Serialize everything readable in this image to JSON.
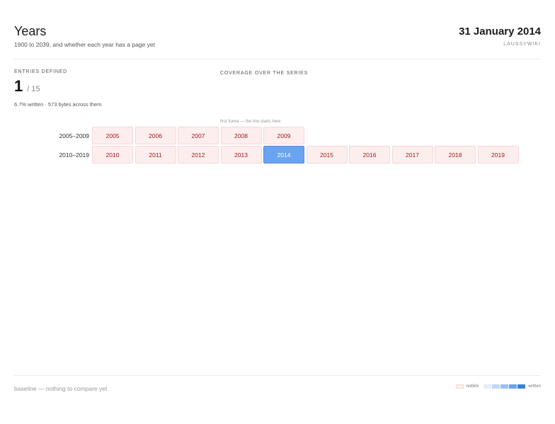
{
  "header": {
    "title": "Years",
    "subtitle": "1900 to 2039, and whether each year has a page yet",
    "date": "31 January 2014",
    "site": "LAUSSYWIKI"
  },
  "stats": {
    "label": "ENTRIES DEFINED",
    "count": "1",
    "total": "/ 15",
    "detail": "6.7% written · 573 bytes across them"
  },
  "coverage": {
    "label": "COVERAGE OVER THE SERIES",
    "frame_note": "first frame — the line starts here."
  },
  "grid": {
    "rows": [
      {
        "label": "2005–2009",
        "years": [
          "2005",
          "2006",
          "2007",
          "2008",
          "2009"
        ]
      },
      {
        "label": "2010–2019",
        "years": [
          "2010",
          "2011",
          "2012",
          "2013",
          "2014",
          "2015",
          "2016",
          "2017",
          "2018",
          "2019"
        ]
      }
    ],
    "current_year": "2014",
    "colors": {
      "redlink_bg": "#fdeeee",
      "redlink_text": "#a01a1a",
      "current_bg": "#6aa3f2"
    }
  },
  "footer": {
    "baseline": "baseline — nothing to compare yet",
    "legend_redlink": "redlink",
    "legend_written": "written"
  }
}
